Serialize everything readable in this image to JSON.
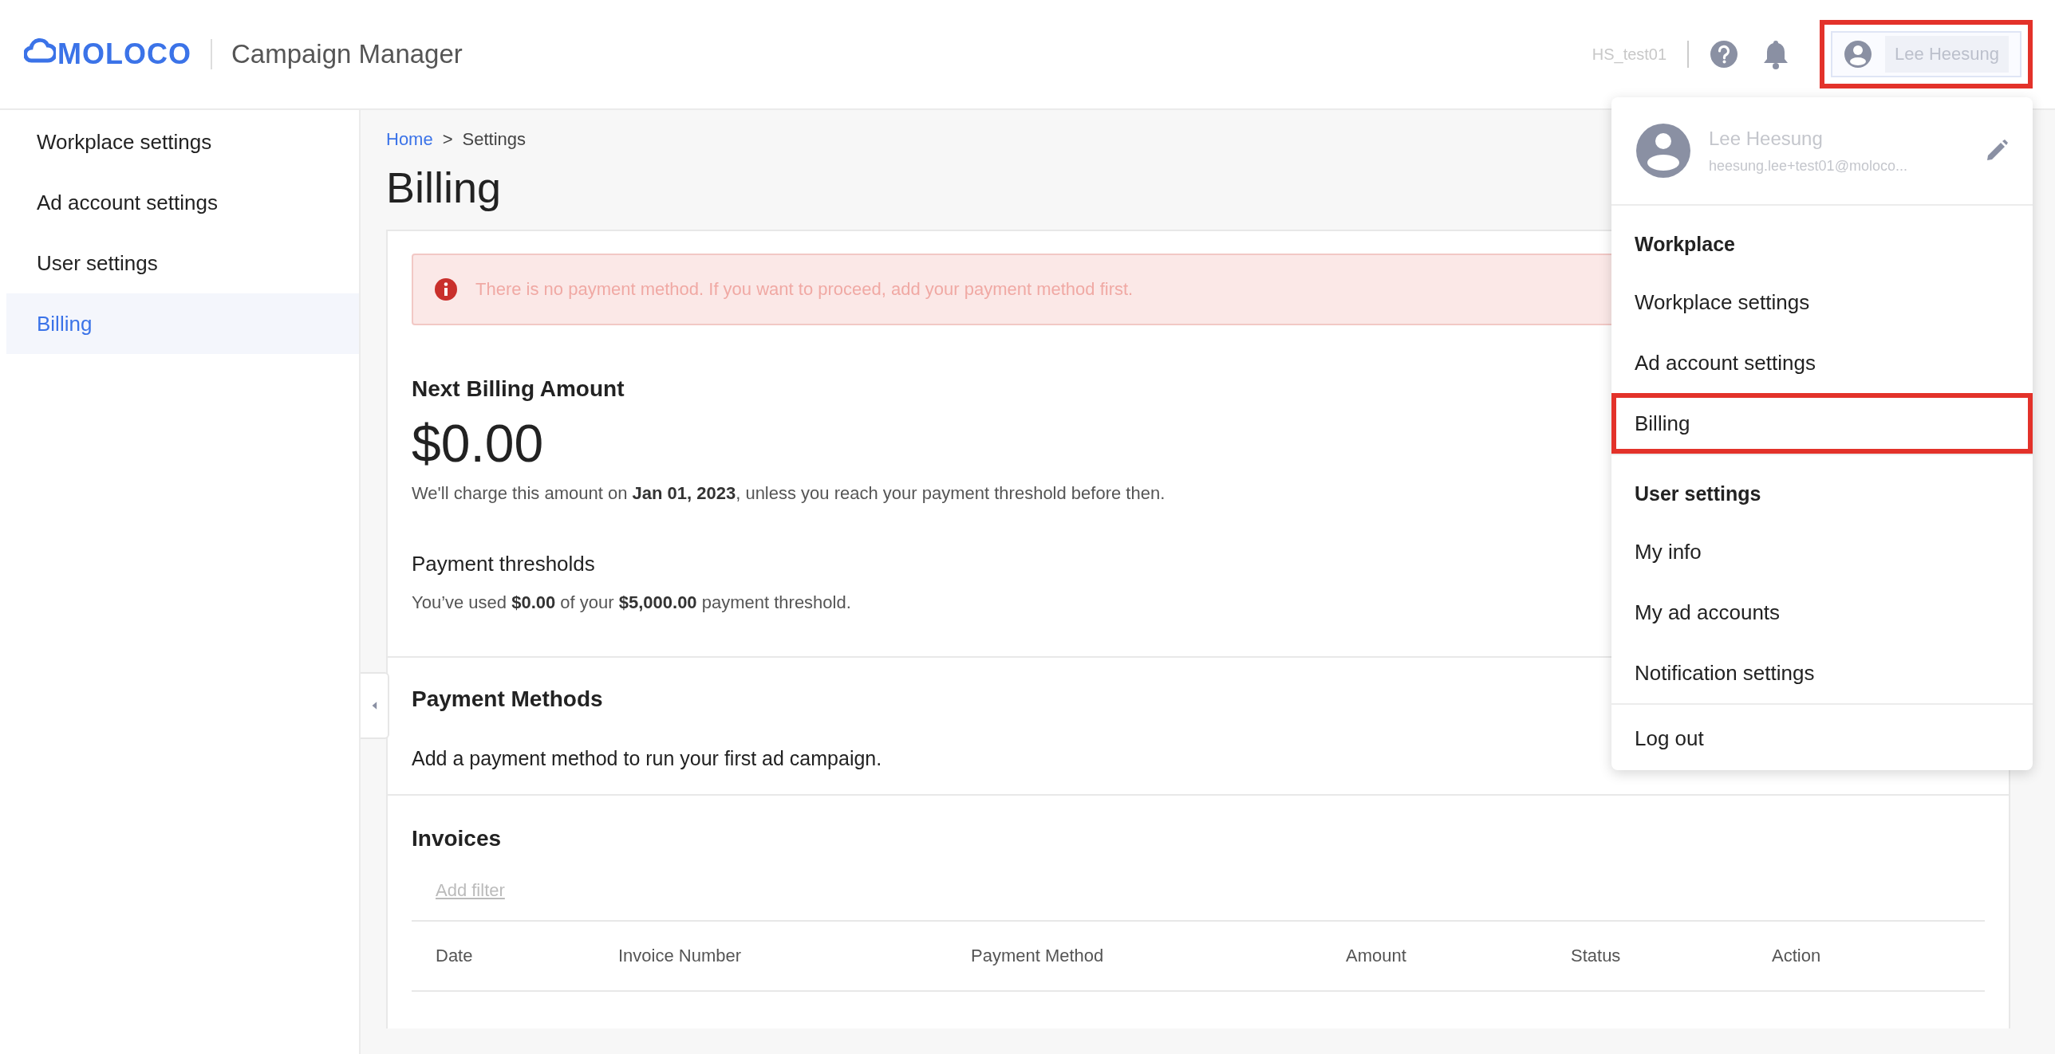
{
  "header": {
    "logo": "MOLOCO",
    "app_title": "Campaign Manager",
    "workspace": "HS_test01",
    "profile_button": {
      "name": "Lee Heesung",
      "highlighted": true
    }
  },
  "sidebar": {
    "items": [
      {
        "label": "Workplace settings",
        "selected": false
      },
      {
        "label": "Ad account settings",
        "selected": false
      },
      {
        "label": "User settings",
        "selected": false
      },
      {
        "label": "Billing",
        "selected": true
      }
    ]
  },
  "breadcrumb": [
    {
      "label": "Home",
      "kind": "link"
    },
    {
      "label": ">",
      "kind": "separator"
    },
    {
      "label": "Settings",
      "kind": "current"
    }
  ],
  "page_title": "Billing",
  "alert": {
    "message": "There is no payment method. If you want to proceed, add your payment method first."
  },
  "next_billing": {
    "title": "Next Billing Amount",
    "amount": "$0.00",
    "note": "We'll charge this amount on **Jan 01, 2023**, unless you reach your payment threshold before then."
  },
  "thresholds": {
    "title": "Payment thresholds",
    "note": "You’ve used **$0.00** of your **$5,000.00** payment threshold."
  },
  "payment_methods": {
    "title": "Payment Methods",
    "note": "Add a payment method to run your first ad campaign."
  },
  "invoices": {
    "title": "Invoices",
    "filter_link": "Add filter",
    "table": {
      "columns": [
        "Date",
        "Invoice Number",
        "Payment Method",
        "Amount",
        "Status",
        "Action"
      ]
    }
  },
  "dropdown": {
    "profile": {
      "name": "Lee Heesung",
      "email": "heesung.lee+test01@moloco..."
    },
    "sections": [
      {
        "title": "Workplace",
        "items": [
          {
            "label": "Workplace settings",
            "highlighted": false
          },
          {
            "label": "Ad account settings",
            "highlighted": false
          },
          {
            "label": "Billing",
            "highlighted": true
          }
        ]
      },
      {
        "title": "User settings",
        "items": [
          {
            "label": "My info",
            "highlighted": false
          },
          {
            "label": "My ad accounts",
            "highlighted": false
          },
          {
            "label": "Notification settings",
            "highlighted": false
          }
        ]
      }
    ],
    "footer_items": [
      {
        "label": "Log out",
        "highlighted": false
      }
    ]
  }
}
